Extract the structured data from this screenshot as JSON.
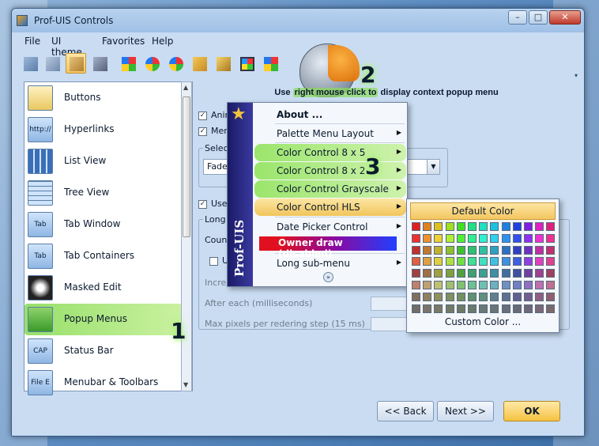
{
  "window": {
    "title": "Prof-UIS Controls"
  },
  "title_buttons": {
    "minimize": "–",
    "maximize": "□",
    "close": "✕"
  },
  "menubar": [
    "File",
    "UI theme",
    "Favorites",
    "Help"
  ],
  "toolbar": {
    "theme_buttons": [
      "theme-2000",
      "theme-xp",
      "theme-2003",
      "theme-2005",
      "theme-xp-luna",
      "theme-vista-8",
      "theme-vista-5",
      "theme-2007-a",
      "theme-2007-b",
      "theme-office",
      "theme-windows"
    ]
  },
  "hint": {
    "prefix": "Use ",
    "highlight": "right mouse click to",
    "suffix": " display context popup menu"
  },
  "left_list": [
    {
      "label": "Buttons",
      "icon": "buttons-icon"
    },
    {
      "label": "Hyperlinks",
      "icon": "hyperlink-icon",
      "icon_text": "http://"
    },
    {
      "label": "List View",
      "icon": "list-view-icon"
    },
    {
      "label": "Tree View",
      "icon": "tree-view-icon"
    },
    {
      "label": "Tab Window",
      "icon": "tab-window-icon",
      "icon_text": "Tab"
    },
    {
      "label": "Tab Containers",
      "icon": "tab-containers-icon",
      "icon_text": "Tab"
    },
    {
      "label": "Masked Edit",
      "icon": "masked-edit-icon"
    },
    {
      "label": "Popup Menus",
      "icon": "popup-menus-icon"
    },
    {
      "label": "Status Bar",
      "icon": "status-bar-icon",
      "icon_text": "CAP"
    },
    {
      "label": "Menubar & Toolbars",
      "icon": "menubar-toolbars-icon",
      "icon_text": "File E"
    }
  ],
  "right_panel": {
    "check1": "Anim",
    "check2": "Men",
    "group_label": "Select",
    "combo_value": "Fade",
    "check3": "Use",
    "long_label": "Long s",
    "count_label": "Count",
    "check4": "U",
    "increase_label": "Increa",
    "after_each": "After each (milliseconds)",
    "max_pixels": "Max pixels per redering step (15 ms)"
  },
  "context_menu": {
    "side_text": "Prof-UIS",
    "items": [
      {
        "label": "About ...",
        "style": "bold"
      },
      {
        "label": "Palette Menu Layout",
        "arrow": true
      },
      {
        "label": "Color Control 8 x 5",
        "arrow": true,
        "style": "green"
      },
      {
        "label": "Color Control 8 x 2",
        "arrow": true,
        "style": "green"
      },
      {
        "label": "Color Control Grayscale",
        "arrow": true,
        "style": "green"
      },
      {
        "label": "Color Control HLS",
        "arrow": true,
        "style": "active"
      },
      {
        "label": "Date Picker Control",
        "arrow": true
      },
      {
        "label": "Owner draw (disabled)"
      },
      {
        "label": "Long sub-menu",
        "arrow": true
      }
    ]
  },
  "color_popup": {
    "default_label": "Default Color",
    "custom_label": "Custom Color ...",
    "colors": [
      "#e02020",
      "#e08020",
      "#e0c020",
      "#a0e020",
      "#40e020",
      "#20e080",
      "#20e0c0",
      "#20c0e0",
      "#2080e0",
      "#2040e0",
      "#8020e0",
      "#e020c0",
      "#e02080",
      "#f03030",
      "#f09030",
      "#f0d030",
      "#b0f030",
      "#50f030",
      "#30f090",
      "#30f0d0",
      "#30d0f0",
      "#3090f0",
      "#3050f0",
      "#9030f0",
      "#f030d0",
      "#f03090",
      "#c03030",
      "#c07830",
      "#c0b030",
      "#90c030",
      "#40c030",
      "#30c070",
      "#30c0a0",
      "#30a0c0",
      "#3070c0",
      "#3040c0",
      "#7030c0",
      "#c030a0",
      "#c03070",
      "#e06040",
      "#e0a040",
      "#e0d040",
      "#b0e040",
      "#70e040",
      "#40e090",
      "#40e0c0",
      "#40c0e0",
      "#4090e0",
      "#4060e0",
      "#9040e0",
      "#e040c0",
      "#e04090",
      "#a04040",
      "#a07040",
      "#a0a040",
      "#80a040",
      "#50a040",
      "#40a070",
      "#40a090",
      "#4090a0",
      "#4070a0",
      "#4050a0",
      "#7040a0",
      "#a04090",
      "#a04060",
      "#c08070",
      "#c0a070",
      "#c0c070",
      "#a0c070",
      "#80c070",
      "#70c090",
      "#70c0b0",
      "#70b0c0",
      "#7090c0",
      "#7080c0",
      "#9070c0",
      "#c070b0",
      "#c07090",
      "#807060",
      "#908060",
      "#909060",
      "#809060",
      "#709060",
      "#609070",
      "#609080",
      "#608090",
      "#607090",
      "#606090",
      "#706090",
      "#906080",
      "#906070",
      "#706c68",
      "#7a7468",
      "#7a7a68",
      "#747a68",
      "#6c7a68",
      "#687a70",
      "#687a78",
      "#68747a",
      "#686e7a",
      "#686a7a",
      "#6e687a",
      "#7a6876",
      "#7a686e"
    ]
  },
  "bottom_buttons": {
    "back": "<< Back",
    "next": "Next >>",
    "ok": "OK"
  },
  "steps": [
    "1",
    "2",
    "3"
  ]
}
